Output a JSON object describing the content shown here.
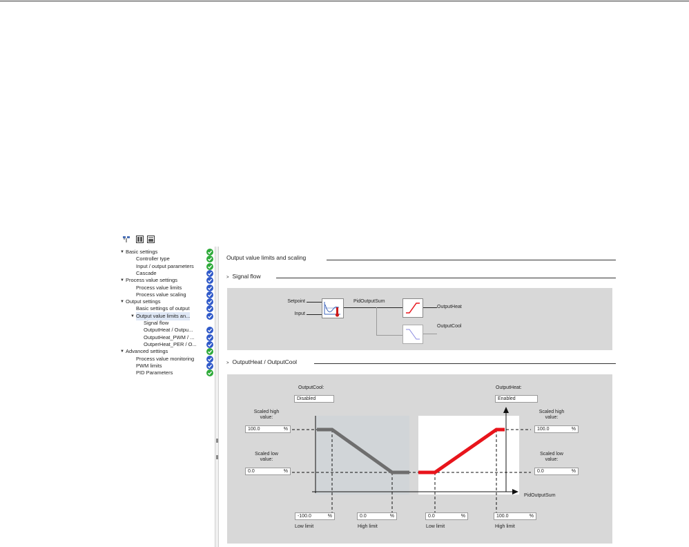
{
  "tree": {
    "items": [
      {
        "label": "Basic settings",
        "status": "green",
        "expandable": true
      },
      {
        "label": "Controller type",
        "status": "green"
      },
      {
        "label": "Input / output parameters",
        "status": "green"
      },
      {
        "label": "Cascade",
        "status": "blue"
      },
      {
        "label": "Process value settings",
        "status": "blue",
        "expandable": true
      },
      {
        "label": "Process value limits",
        "status": "blue"
      },
      {
        "label": "Process value scaling",
        "status": "blue"
      },
      {
        "label": "Output settings",
        "status": "blue",
        "expandable": true
      },
      {
        "label": "Basic settings of output",
        "status": "blue"
      },
      {
        "label": "Output value limits an...",
        "status": "blue",
        "expandable": true,
        "selected": true
      },
      {
        "label": "Signal flow",
        "status": ""
      },
      {
        "label": "OutputHeat / Outpu...",
        "status": "blue"
      },
      {
        "label": "OutputHeat_PWM / ...",
        "status": "blue"
      },
      {
        "label": "OutperHeat_PER / O...",
        "status": "blue"
      },
      {
        "label": "Advanced settings",
        "status": "green",
        "expandable": true
      },
      {
        "label": "Process value monitoring",
        "status": "blue"
      },
      {
        "label": "PWM limits",
        "status": "blue"
      },
      {
        "label": "PID Parameters",
        "status": "green"
      }
    ]
  },
  "main": {
    "title": "Output value limits and scaling",
    "signal_flow": {
      "title": "Signal flow",
      "setpoint": "Setpoint",
      "input": "Input",
      "pid_output_sum": "PidOutputSum",
      "output_heat": "OutputHeat",
      "output_cool": "OutputCool"
    },
    "heat_cool": {
      "title": "OutputHeat / OutputCool",
      "output_cool_label": "OutputCool:",
      "output_cool_value": "Disabled",
      "output_heat_label": "OutputHeat:",
      "output_heat_value": "Enabled",
      "scaled_high_label_1": "Scaled high",
      "scaled_high_label_2": "value:",
      "scaled_low_label_1": "Scaled low",
      "scaled_low_label_2": "value:",
      "cool_scaled_high": "100.0",
      "cool_scaled_low": "0.0",
      "heat_scaled_high": "100.0",
      "heat_scaled_low": "0.0",
      "unit": "%",
      "axis_label": "PidOutputSum",
      "cool_low_limit": "-100.0",
      "cool_high_limit": "0.0",
      "heat_low_limit": "0.0",
      "heat_high_limit": "100.0",
      "low_limit_label": "Low limit",
      "high_limit_label": "High limit"
    }
  },
  "colors": {
    "heat_curve": "#e8141b",
    "cool_curve": "#6e6e6e",
    "ok_status": "#2eaa3a",
    "info_status": "#2f59c9"
  }
}
